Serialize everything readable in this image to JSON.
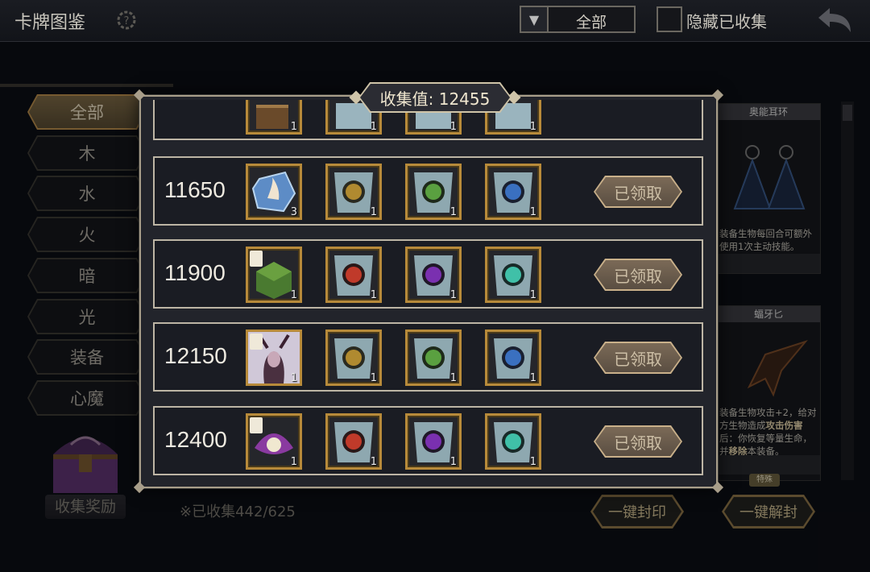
{
  "header": {
    "title": "卡牌图鉴",
    "filter_value": "全部",
    "hide_collected_label": "隐藏已收集"
  },
  "sidebar": {
    "categories": [
      {
        "label": "全部",
        "active": true
      },
      {
        "label": "木"
      },
      {
        "label": "水"
      },
      {
        "label": "火"
      },
      {
        "label": "暗"
      },
      {
        "label": "光"
      },
      {
        "label": "装备"
      },
      {
        "label": "心魔"
      }
    ],
    "collect_reward_label": "收集奖励",
    "collected_text": "※已收集442/625"
  },
  "right_panel": {
    "card1": {
      "title": "奥能耳环",
      "desc": "装备生物每回合可额外使用1次主动技能。"
    },
    "card2": {
      "title": "蝠牙匕",
      "desc_a": "装备生物攻击+2，给对方生物造成",
      "desc_bold1": "攻击伤害",
      "desc_b": "后：你恢复等量生命，并",
      "desc_bold2": "移除",
      "desc_c": "本装备。",
      "tag": "特殊"
    },
    "seal_all_label": "一键封印",
    "unseal_all_label": "一键解封"
  },
  "modal": {
    "title": "收集值: 12455",
    "rows": [
      {
        "value": "",
        "items": [
          {
            "icon": "crate-icon",
            "count": "1"
          },
          {
            "icon": "scroll-icon",
            "count": "1"
          },
          {
            "icon": "scroll-icon",
            "count": "1"
          },
          {
            "icon": "scroll-icon",
            "count": "1"
          }
        ],
        "claim_label": ""
      },
      {
        "value": "11650",
        "items": [
          {
            "icon": "blue-rune-stone-icon",
            "count": "3"
          },
          {
            "icon": "scroll-gold-rune-icon",
            "count": "1"
          },
          {
            "icon": "scroll-green-leaf-icon",
            "count": "1"
          },
          {
            "icon": "scroll-blue-water-icon",
            "count": "1"
          }
        ],
        "claim_label": "已领取"
      },
      {
        "value": "11900",
        "items": [
          {
            "icon": "green-cube-equipment-icon",
            "count": "1"
          },
          {
            "icon": "scroll-red-fire-icon",
            "count": "1"
          },
          {
            "icon": "scroll-purple-dark-icon",
            "count": "1"
          },
          {
            "icon": "scroll-cyan-light-icon",
            "count": "1"
          }
        ],
        "claim_label": "已领取"
      },
      {
        "value": "12150",
        "items": [
          {
            "icon": "demon-portrait-icon",
            "count": "1"
          },
          {
            "icon": "scroll-gold-rune-icon",
            "count": "1"
          },
          {
            "icon": "scroll-green-leaf-icon",
            "count": "1"
          },
          {
            "icon": "scroll-blue-water-icon",
            "count": "1"
          }
        ],
        "claim_label": "已领取"
      },
      {
        "value": "12400",
        "items": [
          {
            "icon": "pearl-shell-equipment-icon",
            "count": "1"
          },
          {
            "icon": "scroll-red-fire-icon",
            "count": "1"
          },
          {
            "icon": "scroll-purple-dark-icon",
            "count": "1"
          },
          {
            "icon": "scroll-cyan-light-icon",
            "count": "1"
          }
        ],
        "claim_label": "已领取"
      }
    ]
  },
  "colors": {
    "gold_border": "#b78a3a",
    "row_border": "#bdb5a5",
    "claimed_button": "#6e5f50"
  }
}
